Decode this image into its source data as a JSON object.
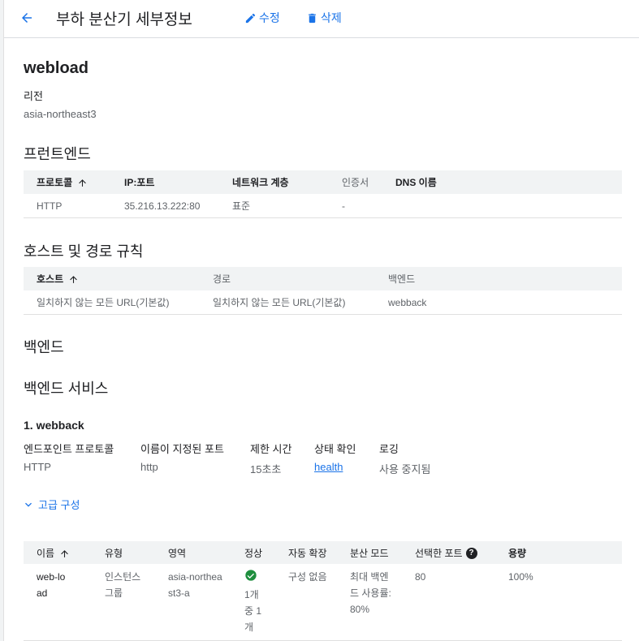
{
  "header": {
    "title": "부하 분산기 세부정보",
    "edit_label": "수정",
    "delete_label": "삭제"
  },
  "lb": {
    "name": "webload",
    "region_label": "리전",
    "region_value": "asia-northeast3"
  },
  "frontend": {
    "title": "프런트엔드",
    "columns": [
      "프로토콜",
      "IP:포트",
      "네트워크 계층",
      "인증서",
      "DNS 이름"
    ],
    "rows": [
      [
        "HTTP",
        "35.216.13.222:80",
        "표준",
        "-",
        ""
      ]
    ]
  },
  "host_rules": {
    "title": "호스트 및 경로 규칙",
    "columns": [
      "호스트",
      "경로",
      "백엔드"
    ],
    "rows": [
      [
        "일치하지 않는 모든 URL(기본값)",
        "일치하지 않는 모든 URL(기본값)",
        "webback"
      ]
    ]
  },
  "backend": {
    "title": "백엔드",
    "services_title": "백엔드 서비스"
  },
  "service": {
    "title": "1. webback",
    "labels": [
      "엔드포인트 프로토콜",
      "이름이 지정된 포트",
      "제한 시간",
      "상태 확인",
      "로깅"
    ],
    "values": [
      "HTTP",
      "http",
      "15초초",
      "health",
      "사용 중지됨"
    ]
  },
  "advanced_label": "고급 구성",
  "backends_table": {
    "columns": [
      "이름",
      "유형",
      "영역",
      "정상",
      "자동 확장",
      "분산 모드",
      "선택한 포트",
      "용량"
    ],
    "rows": [
      [
        "web-load",
        "인스턴스 그룹",
        "asia-northeast3-a",
        "1개 중 1개",
        "구성 없음",
        "최대 백엔드 사용률: 80%",
        "80",
        "100%"
      ]
    ]
  },
  "colors": {
    "accent": "#1a73e8",
    "healthy": "#1e8e3e",
    "header_bg": "#f1f3f4"
  }
}
